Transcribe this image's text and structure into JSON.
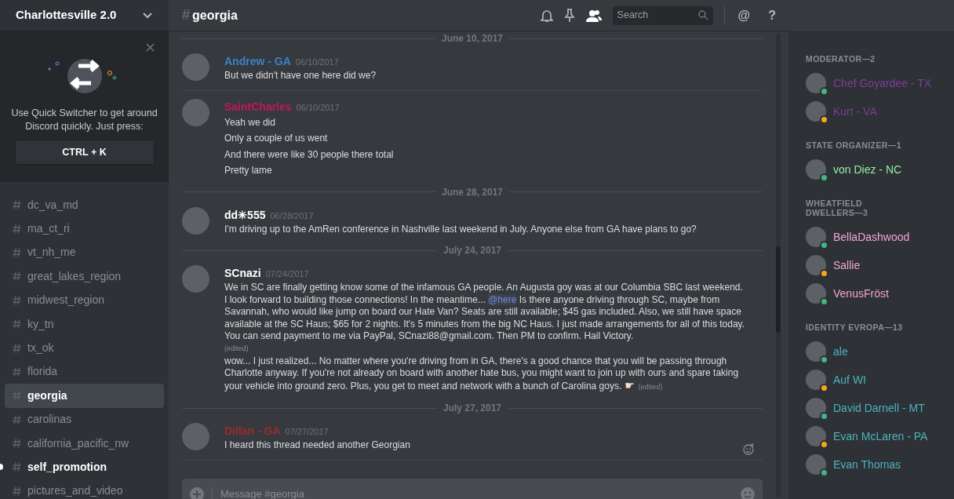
{
  "server": {
    "name": "Charlottesville 2.0"
  },
  "tip": {
    "text": "Use Quick Switcher to get around Discord quickly. Just press:",
    "shortcut": "CTRL + K"
  },
  "channels": [
    {
      "name": "dc_va_md",
      "selected": false,
      "unread": false
    },
    {
      "name": "ma_ct_ri",
      "selected": false,
      "unread": false
    },
    {
      "name": "vt_nh_me",
      "selected": false,
      "unread": false
    },
    {
      "name": "great_lakes_region",
      "selected": false,
      "unread": false
    },
    {
      "name": "midwest_region",
      "selected": false,
      "unread": false
    },
    {
      "name": "ky_tn",
      "selected": false,
      "unread": false
    },
    {
      "name": "tx_ok",
      "selected": false,
      "unread": false
    },
    {
      "name": "florida",
      "selected": false,
      "unread": false
    },
    {
      "name": "georgia",
      "selected": true,
      "unread": false
    },
    {
      "name": "carolinas",
      "selected": false,
      "unread": false
    },
    {
      "name": "california_pacific_nw",
      "selected": false,
      "unread": false
    },
    {
      "name": "self_promotion",
      "selected": false,
      "unread": true
    },
    {
      "name": "pictures_and_video",
      "selected": false,
      "unread": false
    }
  ],
  "channel_header": {
    "hash": "#",
    "name": "georgia",
    "search_placeholder": "Search",
    "at": "@",
    "help": "?"
  },
  "messages": [
    {
      "kind": "divider",
      "date": "June 10, 2017"
    },
    {
      "kind": "group",
      "author": "Andrew - GA",
      "color": "#3e82c6",
      "time": "06/10/2017",
      "lines": [
        {
          "parts": [
            {
              "text": "But we didn't have one here did we?",
              "kind": "text"
            }
          ]
        }
      ]
    },
    {
      "kind": "group",
      "author": "SaintCharles",
      "color": "#c2185b",
      "time": "06/10/2017",
      "lines": [
        {
          "parts": [
            {
              "text": "Yeah we did",
              "kind": "text"
            }
          ]
        },
        {
          "parts": [
            {
              "text": "Only a couple of us went",
              "kind": "text"
            }
          ]
        },
        {
          "parts": [
            {
              "text": "And there were like 30 people there total",
              "kind": "text"
            }
          ]
        },
        {
          "parts": [
            {
              "text": "Pretty lame",
              "kind": "text"
            }
          ]
        }
      ]
    },
    {
      "kind": "divider",
      "date": "June 28, 2017"
    },
    {
      "kind": "group",
      "author": "dd✳555",
      "color": "#ffffff",
      "time": "06/28/2017",
      "lines": [
        {
          "parts": [
            {
              "text": "I'm driving up to the AmRen conference in Nashville  last weekend in July.  Anyone else from GA have plans to go?",
              "kind": "text"
            }
          ]
        }
      ]
    },
    {
      "kind": "divider",
      "date": "July 24, 2017"
    },
    {
      "kind": "group",
      "author": "SCnazi",
      "color": "#ffffff",
      "time": "07/24/2017",
      "lines": [
        {
          "parts": [
            {
              "text": "We in SC are finally getting know some of the infamous GA people. An Augusta goy was at our Columbia SBC last weekend. I look forward to building those connections! In the meantime... ",
              "kind": "text"
            },
            {
              "text": "@here",
              "kind": "mention"
            },
            {
              "text": " Is there anyone driving through SC, maybe from Savannah, who would like jump on board our Hate Van? Seats are still available; $45 gas included. Also, we still have space available at the SC Haus; $65 for 2 nights. It's 5 minutes from the big NC Haus. I just made arrangements for all of this today. You can send payment to me via PayPal, SCnazi88@gmail.com. Then PM to confirm. Hail Victory.",
              "kind": "text"
            }
          ],
          "edited": "(edited)",
          "edited_below": true
        },
        {
          "parts": [
            {
              "text": "wow... I just realized... No matter where you're driving from in GA, there's a good chance that you will be passing through Charlotte anyway. If you're not already on board with another hate bus, you might want to join up with ours and spare taking your vehicle into ground zero. Plus, you get to meet and network with a bunch of Carolina goys.",
              "kind": "text"
            }
          ],
          "emoji": "☛",
          "edited": "(edited)",
          "edited_below": false
        }
      ]
    },
    {
      "kind": "divider",
      "date": "July 27, 2017"
    },
    {
      "kind": "group",
      "author": "Dillan - GA",
      "color": "#9b2c2c",
      "time": "07/27/2017",
      "lines": [
        {
          "parts": [
            {
              "text": "I heard this thread needed another Georgian",
              "kind": "text"
            }
          ]
        }
      ]
    }
  ],
  "composer": {
    "placeholder": "Message #georgia"
  },
  "member_groups": [
    {
      "title": "MODERATOR—2",
      "color": "#7b3f99",
      "members": [
        {
          "name": "Chef Goyardee - TX",
          "color": "#43b581"
        },
        {
          "name": "Kurt - VA",
          "color": "#faa61a"
        }
      ]
    },
    {
      "title": "STATE ORGANIZER—1",
      "color": "#8ff0a4",
      "members": [
        {
          "name": "von Diez - NC",
          "color": "#43b581"
        }
      ]
    },
    {
      "title": "WHEATFIELD DWELLERS—3",
      "color": "#f2a5d3",
      "members": [
        {
          "name": "BellaDashwood",
          "color": "#43b581"
        },
        {
          "name": "Sallie",
          "color": "#faa61a"
        },
        {
          "name": "VenusFröst",
          "color": "#43b581"
        }
      ]
    },
    {
      "title": "IDENTITY EVROPA—13",
      "color": "#4bb3bf",
      "members": [
        {
          "name": "ale",
          "color": "#43b581"
        },
        {
          "name": "Auf WI",
          "color": "#faa61a"
        },
        {
          "name": "David Darnell - MT",
          "color": "#43b581"
        },
        {
          "name": "Evan McLaren - PA",
          "color": "#faa61a"
        },
        {
          "name": "Evan Thomas",
          "color": "#43b581"
        }
      ]
    }
  ]
}
